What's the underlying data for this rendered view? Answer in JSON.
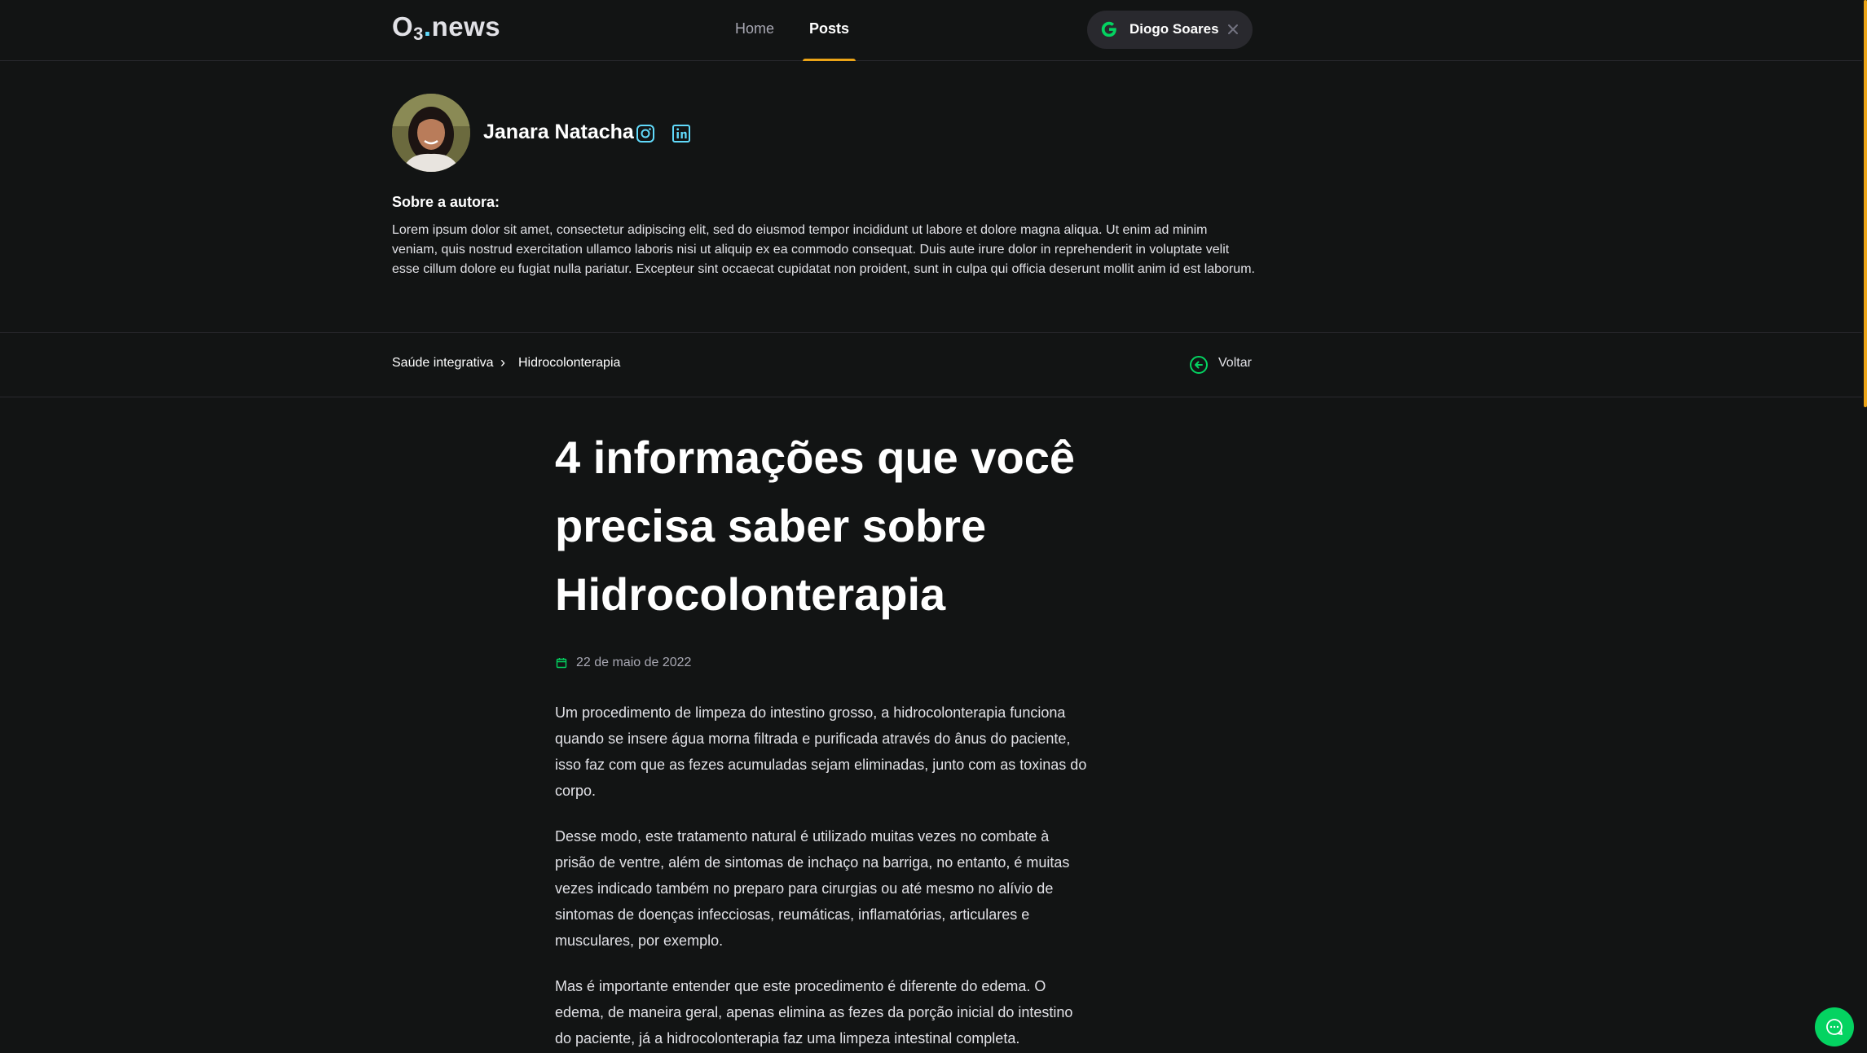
{
  "header": {
    "logo": {
      "main": "O",
      "sub": "3",
      "dot": ".",
      "rest": "news"
    },
    "nav": [
      {
        "label": "Home",
        "active": false
      },
      {
        "label": "Posts",
        "active": true
      }
    ],
    "user": {
      "name": "Diogo Soares",
      "provider_icon": "google-icon"
    }
  },
  "author": {
    "name": "Janara Natacha",
    "social": [
      "instagram-icon",
      "linkedin-icon"
    ],
    "about_title": "Sobre a autora:",
    "about_text": "Lorem ipsum dolor sit amet, consectetur adipiscing elit, sed do eiusmod tempor incididunt ut labore et dolore magna aliqua. Ut enim ad minim veniam, quis nostrud exercitation ullamco laboris nisi ut aliquip ex ea commodo consequat. Duis aute irure dolor in reprehenderit in voluptate velit esse cillum dolore eu fugiat nulla pariatur. Excepteur sint occaecat cupidatat non proident, sunt in culpa qui officia deserunt mollit anim id est laborum."
  },
  "breadcrumb": {
    "items": [
      "Saúde integrativa",
      "Hidrocolonterapia"
    ],
    "separator": "›",
    "back_label": "Voltar"
  },
  "post": {
    "title_lines": [
      "4 informações que você",
      "precisa saber sobre",
      "Hidrocolonterapia"
    ],
    "date": "22 de maio de 2022",
    "paragraphs": [
      "Um procedimento de limpeza do intestino grosso, a hidrocolonterapia funciona quando se insere água morna filtrada e purificada através do ânus do paciente, isso faz com que as fezes acumuladas sejam eliminadas, junto com as toxinas do corpo.",
      "Desse modo, este tratamento natural é utilizado muitas vezes no combate à prisão de ventre, além de sintomas de inchaço na barriga, no entanto, é muitas vezes indicado também no preparo para cirurgias ou até mesmo no alívio de sintomas de doenças infecciosas, reumáticas, inflamatórias, articulares e musculares, por exemplo.",
      "Mas é importante entender que este procedimento é diferente do edema. O edema, de maneira geral, apenas elimina as fezes da porção inicial do intestino do paciente, já a hidrocolonterapia faz uma limpeza intestinal completa."
    ]
  },
  "colors": {
    "background": "#121414",
    "accent": "#eba417",
    "green": "#04d361",
    "social": "#61dafb"
  }
}
